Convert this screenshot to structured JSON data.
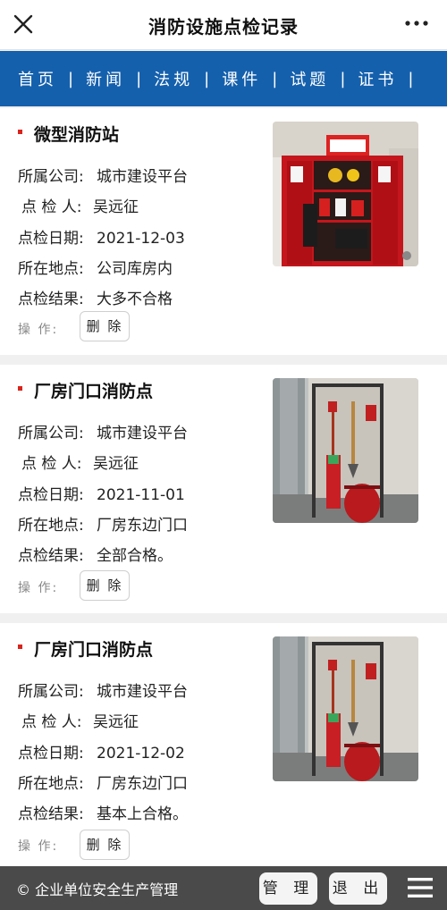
{
  "header": {
    "title": "消防设施点检记录",
    "close_icon": "close-icon",
    "more_icon": "more-dots-icon"
  },
  "nav": {
    "items": [
      {
        "label": "首页"
      },
      {
        "label": "新闻"
      },
      {
        "label": "法规"
      },
      {
        "label": "课件"
      },
      {
        "label": "试题"
      },
      {
        "label": "证书"
      }
    ],
    "separator": "|"
  },
  "labels": {
    "company": "所属公司:",
    "inspector": "点 检 人:",
    "date": "点检日期:",
    "location": "所在地点:",
    "result": "点检结果:",
    "operation": "操 作:",
    "delete": "删 除"
  },
  "records": [
    {
      "name": "微型消防站",
      "company": "城市建设平台",
      "inspector": "吴远征",
      "date": "2021-12-03",
      "location": "公司库房内",
      "result": "大多不合格",
      "photo": "fire-cabinet-photo"
    },
    {
      "name": "厂房门口消防点",
      "company": "城市建设平台",
      "inspector": "吴远征",
      "date": "2021-11-01",
      "location": "厂房东边门口",
      "result": "全部合格。",
      "photo": "fire-station-rack-photo"
    },
    {
      "name": "厂房门口消防点",
      "company": "城市建设平台",
      "inspector": "吴远征",
      "date": "2021-12-02",
      "location": "厂房东边门口",
      "result": "基本上合格。",
      "photo": "fire-station-rack-photo"
    }
  ],
  "footer": {
    "copyright": "© 企业单位安全生产管理",
    "manage_label": "管 理",
    "logout_label": "退 出",
    "menu_icon": "hamburger-menu-icon"
  },
  "colors": {
    "nav_bg": "#1560ad",
    "accent_dot": "#d9241c",
    "footer_bg": "#4a4a4a"
  }
}
